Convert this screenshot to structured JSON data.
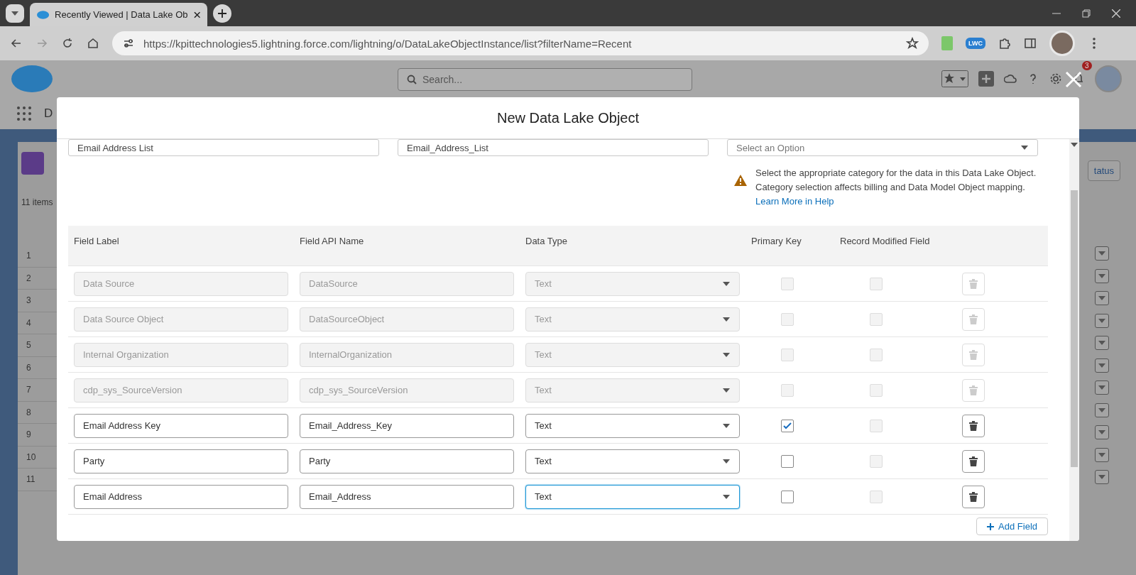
{
  "browser": {
    "tab_title": "Recently Viewed | Data Lake Ob",
    "url": "https://kpittechnologies5.lightning.force.com/lightning/o/DataLakeObjectInstance/list?filterName=Recent",
    "extension_badge": "LWC"
  },
  "app_header": {
    "search_placeholder": "Search...",
    "notification_count": "3",
    "nav_letter": "D"
  },
  "background_list": {
    "item_count": "11 items",
    "status_button": "tatus",
    "row_numbers": [
      "1",
      "2",
      "3",
      "4",
      "5",
      "6",
      "7",
      "8",
      "9",
      "10",
      "11"
    ]
  },
  "modal": {
    "title": "New Data Lake Object",
    "object_label": "Email Address List",
    "object_api_name": "Email_Address_List",
    "category_placeholder": "Select an Option",
    "category_help": "Select the appropriate category for the data in this Data Lake Object. Category selection affects billing and Data Model Object mapping.",
    "help_link": "Learn More in Help",
    "columns": [
      "Field Label",
      "Field API Name",
      "Data Type",
      "Primary Key",
      "Record Modified Field"
    ],
    "rows": [
      {
        "label": "Data Source",
        "api_name": "DataSource",
        "data_type": "Text",
        "disabled": true,
        "primary_key": false,
        "record_modified": false,
        "focused": false
      },
      {
        "label": "Data Source Object",
        "api_name": "DataSourceObject",
        "data_type": "Text",
        "disabled": true,
        "primary_key": false,
        "record_modified": false,
        "focused": false
      },
      {
        "label": "Internal Organization",
        "api_name": "InternalOrganization",
        "data_type": "Text",
        "disabled": true,
        "primary_key": false,
        "record_modified": false,
        "focused": false
      },
      {
        "label": "cdp_sys_SourceVersion",
        "api_name": "cdp_sys_SourceVersion",
        "data_type": "Text",
        "disabled": true,
        "primary_key": false,
        "record_modified": false,
        "focused": false
      },
      {
        "label": "Email Address Key",
        "api_name": "Email_Address_Key",
        "data_type": "Text",
        "disabled": false,
        "primary_key": true,
        "record_modified": false,
        "focused": false
      },
      {
        "label": "Party",
        "api_name": "Party",
        "data_type": "Text",
        "disabled": false,
        "primary_key": false,
        "record_modified": false,
        "focused": false
      },
      {
        "label": "Email Address",
        "api_name": "Email_Address",
        "data_type": "Text",
        "disabled": false,
        "primary_key": false,
        "record_modified": false,
        "focused": true
      }
    ],
    "add_field_button": "Add Field"
  }
}
